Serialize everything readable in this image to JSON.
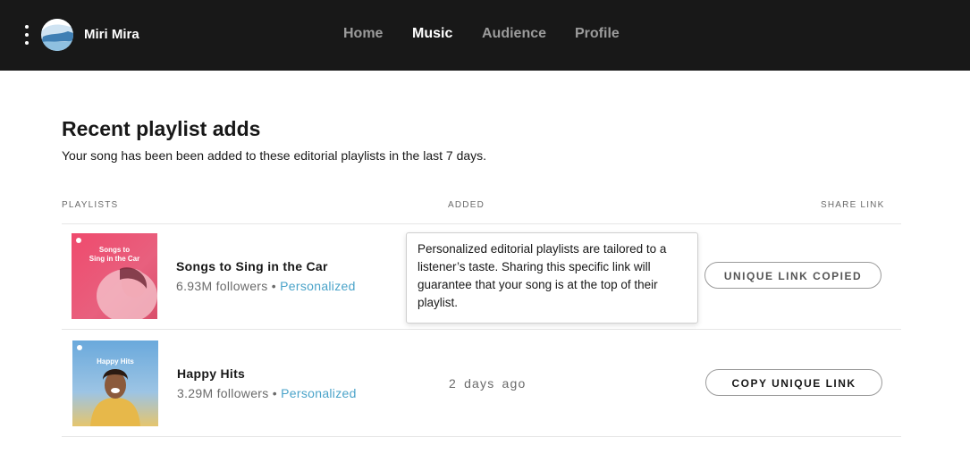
{
  "header": {
    "user_name": "Miri Mira",
    "nav": [
      {
        "label": "Home",
        "active": false
      },
      {
        "label": "Music",
        "active": true
      },
      {
        "label": "Audience",
        "active": false
      },
      {
        "label": "Profile",
        "active": false
      }
    ]
  },
  "main": {
    "title": "Recent playlist adds",
    "subtitle": "Your song has been been added to these editorial playlists in the last 7 days.",
    "columns": {
      "playlists": "PLAYLISTS",
      "added": "ADDED",
      "share_link": "SHARE LINK"
    },
    "rows": [
      {
        "cover_text": [
          "Songs to",
          "Sing in the Car"
        ],
        "name": "Songs to Sing in the Car",
        "followers": "6.93M followers",
        "separator": "•",
        "tag": "Personalized",
        "added": "",
        "button_label": "UNIQUE LINK COPIED"
      },
      {
        "cover_text": [
          "Happy Hits"
        ],
        "name": "Happy Hits",
        "followers": "3.29M followers",
        "separator": "•",
        "tag": "Personalized",
        "added": "2 days ago",
        "button_label": "COPY UNIQUE LINK"
      }
    ],
    "tooltip": "Personalized editorial playlists are tailored to a listener’s taste. Sharing this specific link will guarantee that your song is at the top of their playlist."
  },
  "colors": {
    "topbar": "#181818",
    "accent_link": "#4aa3c9",
    "muted_text": "#6a6a6a"
  },
  "icons": {
    "menu": "kebab-menu-icon",
    "avatar": "user-avatar"
  }
}
